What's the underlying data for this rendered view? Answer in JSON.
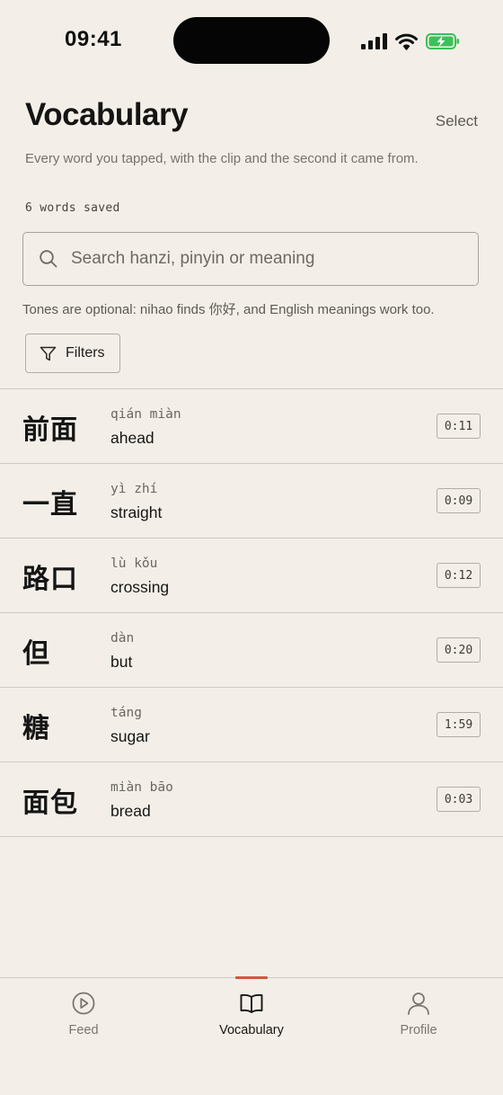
{
  "status_bar": {
    "time": "09:41"
  },
  "header": {
    "title": "Vocabulary",
    "select_label": "Select",
    "subtitle": "Every word you tapped, with the clip and the second it came from.",
    "saved_count": "6 words saved"
  },
  "search": {
    "placeholder": "Search hanzi, pinyin or meaning",
    "value": "",
    "hint": "Tones are optional: nihao finds 你好, and English meanings work too."
  },
  "filters": {
    "label": "Filters"
  },
  "words": [
    {
      "hanzi": "前面",
      "pinyin": "qián miàn",
      "meaning": "ahead",
      "timestamp": "0:11"
    },
    {
      "hanzi": "一直",
      "pinyin": "yì zhí",
      "meaning": "straight",
      "timestamp": "0:09"
    },
    {
      "hanzi": "路口",
      "pinyin": "lù kǒu",
      "meaning": "crossing",
      "timestamp": "0:12"
    },
    {
      "hanzi": "但",
      "pinyin": "dàn",
      "meaning": "but",
      "timestamp": "0:20"
    },
    {
      "hanzi": "糖",
      "pinyin": "táng",
      "meaning": "sugar",
      "timestamp": "1:59"
    },
    {
      "hanzi": "面包",
      "pinyin": "miàn bāo",
      "meaning": "bread",
      "timestamp": "0:03"
    }
  ],
  "tab_bar": {
    "tabs": [
      {
        "label": "Feed",
        "icon": "play-circle-icon",
        "active": false
      },
      {
        "label": "Vocabulary",
        "icon": "book-open-icon",
        "active": true
      },
      {
        "label": "Profile",
        "icon": "user-icon",
        "active": false
      }
    ]
  },
  "colors": {
    "background": "#f3efe8",
    "accent": "#d4563f",
    "battery": "#3fbf5a",
    "divider": "#cfcbc4"
  }
}
